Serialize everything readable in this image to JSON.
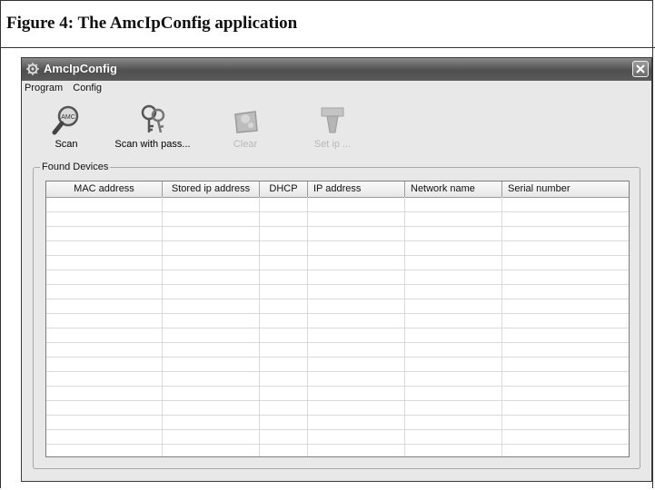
{
  "figure": {
    "caption": "Figure 4: The AmcIpConfig application"
  },
  "window": {
    "title": "AmcIpConfig"
  },
  "menu": {
    "items": [
      "Program",
      "Config"
    ]
  },
  "toolbar": {
    "scan": "Scan",
    "scan_with_pass": "Scan with pass...",
    "clear": "Clear",
    "set_ip": "Set ip ..."
  },
  "found_devices": {
    "label": "Found Devices",
    "columns": [
      "MAC address",
      "Stored ip address",
      "DHCP",
      "IP address",
      "Network name",
      "Serial number"
    ]
  }
}
